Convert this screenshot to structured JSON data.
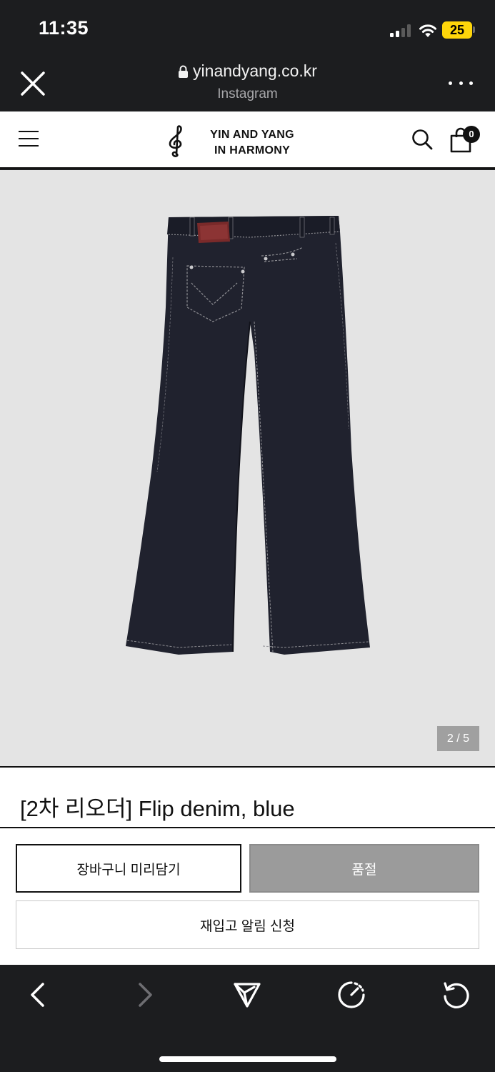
{
  "status_bar": {
    "time": "11:35",
    "battery": "25",
    "icons": [
      "cellular-signal-icon",
      "wifi-icon",
      "battery-icon"
    ]
  },
  "browser": {
    "url": "yinandyang.co.kr",
    "source": "Instagram",
    "icons": [
      "close-icon",
      "lock-icon",
      "more-icon"
    ]
  },
  "site_header": {
    "logo_line1": "YIN AND YANG",
    "logo_line2": "IN HARMONY",
    "cart_count": "0",
    "icons": [
      "hamburger-menu-icon",
      "treble-clef-logo-icon",
      "search-icon",
      "shopping-bag-icon"
    ]
  },
  "gallery": {
    "counter": "2 / 5",
    "background": "#e4e4e4",
    "image": "dark-denim-flare-jeans"
  },
  "product": {
    "title": "[2차 리오더] Flip denim, blue",
    "cart_preview_label": "장바구니 미리담기",
    "soldout_label": "품절",
    "restock_notify_label": "재입고 알림 신청"
  },
  "toolbar": {
    "icons": [
      "back-arrow-icon",
      "forward-arrow-icon",
      "share-icon",
      "speed-icon",
      "reload-icon"
    ]
  },
  "colors": {
    "chrome": "#1c1d1f",
    "soldout": "#9b9b9b",
    "battery": "#ffd60a"
  }
}
